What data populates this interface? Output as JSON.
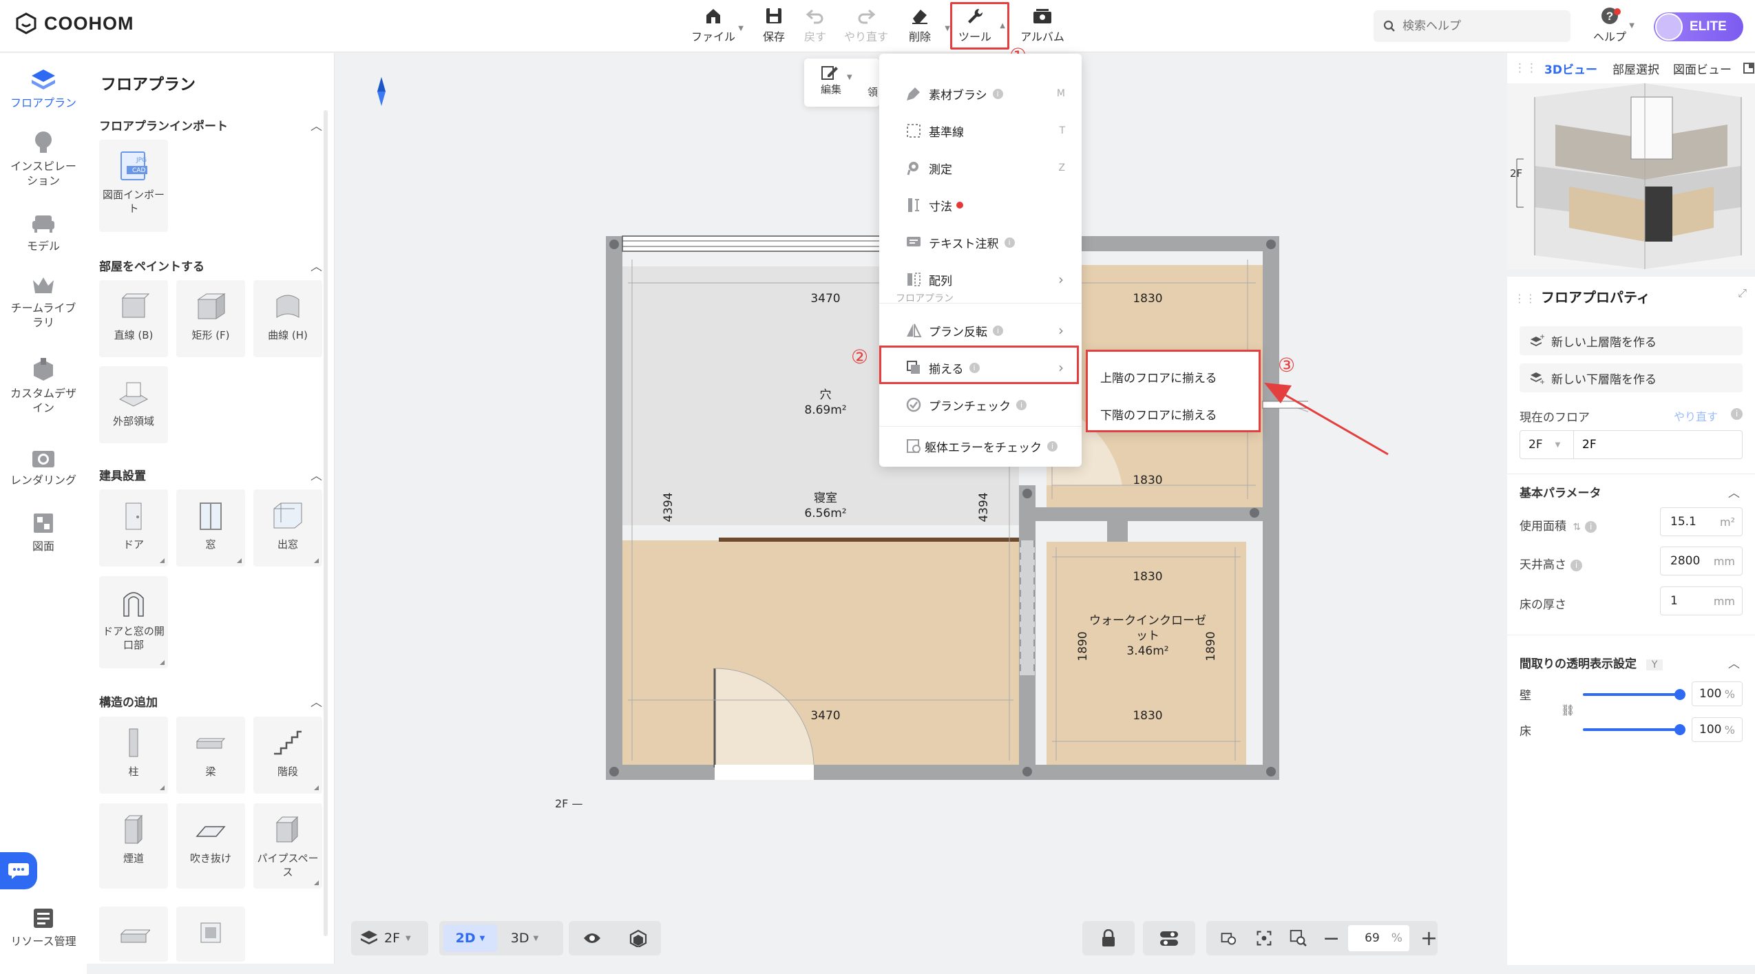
{
  "app": {
    "logo_text": "COOHOM"
  },
  "toolbar": {
    "file": "ファイル",
    "save": "保存",
    "undo": "戻す",
    "redo": "やり直す",
    "delete": "削除",
    "tools": "ツール",
    "album": "アルバム"
  },
  "search": {
    "placeholder": "検索ヘルプ"
  },
  "help": {
    "label": "ヘルプ"
  },
  "user": {
    "badge": "ELITE"
  },
  "leftnav": {
    "items": [
      {
        "label": "フロアプラン"
      },
      {
        "label": "インスピレーション"
      },
      {
        "label": "モデル"
      },
      {
        "label": "チームライブラリ"
      },
      {
        "label": "カスタムデザイン"
      },
      {
        "label": "レンダリング"
      },
      {
        "label": "図面"
      }
    ],
    "resource": "リソース管理"
  },
  "panel": {
    "title": "フロアプラン",
    "import_section": "フロアプランインポート",
    "import_card": "図面インポート",
    "import_tags": [
      "JPG",
      "CAD"
    ],
    "paint_section": "部屋をペイントする",
    "paint_items": [
      "直線 (B)",
      "矩形 (F)",
      "曲線 (H)",
      "外部領域"
    ],
    "fixtures_section": "建具設置",
    "fixture_items": [
      "ドア",
      "窓",
      "出窓",
      "ドアと窓の開口部"
    ],
    "structure_section": "構造の追加",
    "structure_items": [
      "柱",
      "梁",
      "階段",
      "煙道",
      "吹き抜け",
      "パイプスペース"
    ]
  },
  "edit_toolbar": {
    "edit": "編集",
    "partial": "領"
  },
  "tools_menu": {
    "items": [
      {
        "label": "素材ブラシ",
        "key": "M"
      },
      {
        "label": "基準線",
        "key": "T"
      },
      {
        "label": "測定",
        "key": "Z"
      },
      {
        "label": "寸法"
      },
      {
        "label": "テキスト注釈"
      },
      {
        "label": "配列"
      }
    ],
    "group_label": "フロアプラン",
    "group_items": [
      {
        "label": "プラン反転"
      },
      {
        "label": "揃える"
      },
      {
        "label": "プランチェック"
      }
    ],
    "bottom_item": "躯体エラーをチェック"
  },
  "submenu": {
    "items": [
      "上階のフロアに揃える",
      "下階のフロアに揃える"
    ]
  },
  "annotations": {
    "step1": "①",
    "step2": "②",
    "step3": "③",
    "highlight_color": "#e53e3e"
  },
  "floorplan": {
    "rooms": [
      {
        "name": "穴",
        "area": "8.69m²"
      },
      {
        "name": "寝室",
        "area": "6.56m²"
      },
      {
        "name": "ウォークインクローゼット",
        "area": "3.46m²"
      }
    ],
    "dims": {
      "top_left": "3470",
      "top_right": "1830",
      "mid_right": "1830",
      "closet_top": "1830",
      "bottom_left": "3470",
      "bottom_right": "1830",
      "left_v": "4394",
      "center_v": "4394",
      "closet_left_v": "1890",
      "closet_right_v": "1890"
    },
    "floor_marker": "2F —"
  },
  "bottombar": {
    "floor": "2F",
    "mode2d": "2D",
    "mode3d": "3D",
    "zoom": "69",
    "zoom_unit": "%"
  },
  "right": {
    "tabs": [
      "3Dビュー",
      "部屋選択",
      "図面ビュー"
    ],
    "view_floor_label": "2F",
    "props_title": "フロアプロパティ",
    "new_upper": "新しい上層階を作る",
    "new_lower": "新しい下層階を作る",
    "current_floor_label": "現在のフロア",
    "current_floor_action": "やり直す",
    "floor_select": "2F",
    "floor_name": "2F",
    "basic_params": "基本パラメータ",
    "area_label": "使用面積",
    "area_value": "15.1",
    "area_unit": "m²",
    "ceiling_label": "天井高さ",
    "ceiling_value": "2800",
    "ceiling_unit": "mm",
    "floor_thick_label": "床の厚さ",
    "floor_thick_value": "1",
    "floor_thick_unit": "mm",
    "transparency_title": "間取りの透明表示設定",
    "transparency_key": "Y",
    "wall_label": "壁",
    "wall_value": "100",
    "floor_label": "床",
    "floor_value": "100",
    "pct": "%"
  },
  "colors": {
    "accent": "#2f6bf2",
    "wood": "#e6cfae",
    "wall": "#a5a6a8",
    "hole": "#e3e3e3",
    "annotation": "#e53e3e"
  }
}
